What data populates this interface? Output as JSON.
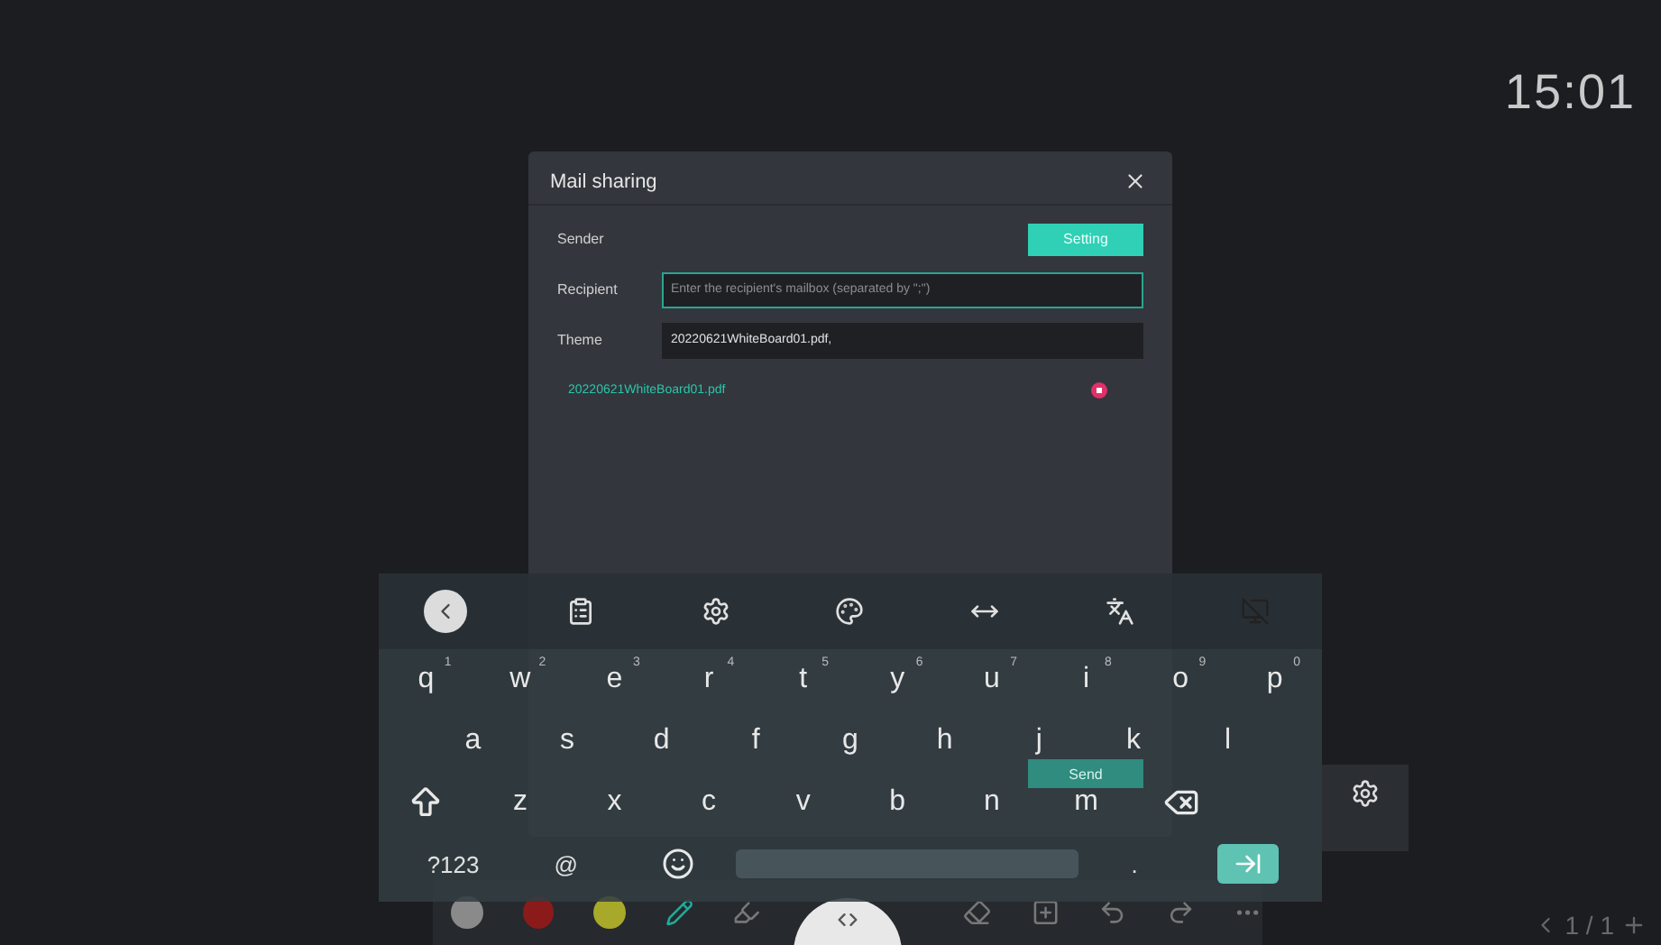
{
  "clock": "15:01",
  "dialog": {
    "title": "Mail sharing",
    "fields": [
      {
        "kind": "button",
        "label": "Sender",
        "button": "Setting"
      },
      {
        "kind": "input",
        "label": "Recipient",
        "placeholder": "Enter the recipient's mailbox (separated by \";\")",
        "focused": true
      },
      {
        "kind": "input",
        "label": "Theme",
        "value": "20220621WhiteBoard01.pdf,",
        "focused": false
      }
    ],
    "attachment": "20220621WhiteBoard01.pdf",
    "send": "Send"
  },
  "keyboard": {
    "rows": [
      [
        {
          "key": "q",
          "hint": "1"
        },
        {
          "key": "w",
          "hint": "2"
        },
        {
          "key": "e",
          "hint": "3"
        },
        {
          "key": "r",
          "hint": "4"
        },
        {
          "key": "t",
          "hint": "5"
        },
        {
          "key": "y",
          "hint": "6"
        },
        {
          "key": "u",
          "hint": "7"
        },
        {
          "key": "i",
          "hint": "8"
        },
        {
          "key": "o",
          "hint": "9"
        },
        {
          "key": "p",
          "hint": "0"
        }
      ],
      [
        {
          "key": "a"
        },
        {
          "key": "s"
        },
        {
          "key": "d"
        },
        {
          "key": "f"
        },
        {
          "key": "g"
        },
        {
          "key": "h"
        },
        {
          "key": "j"
        },
        {
          "key": "k"
        },
        {
          "key": "l"
        }
      ],
      [
        {
          "key": "z"
        },
        {
          "key": "x"
        },
        {
          "key": "c"
        },
        {
          "key": "v"
        },
        {
          "key": "b"
        },
        {
          "key": "n"
        },
        {
          "key": "m"
        }
      ]
    ],
    "symbols": "?123",
    "at": "@",
    "period": "."
  },
  "toolbar": {
    "colors": [
      {
        "color": "#8a8a8a"
      },
      {
        "color": "#8b1a1a"
      },
      {
        "color": "#a8a82a"
      }
    ]
  },
  "page": "1 / 1"
}
